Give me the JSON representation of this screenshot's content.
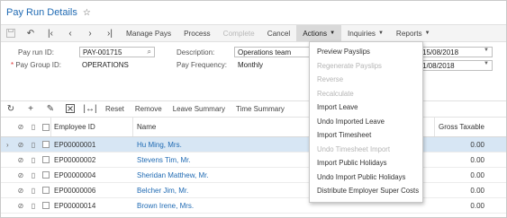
{
  "page": {
    "title": "Pay Run Details"
  },
  "toolbar": {
    "buttons": [
      {
        "label": "Manage Pays",
        "disabled": false
      },
      {
        "label": "Process",
        "disabled": false
      },
      {
        "label": "Complete",
        "disabled": true
      },
      {
        "label": "Cancel",
        "disabled": false
      }
    ],
    "actions_label": "Actions",
    "inquiries_label": "Inquiries",
    "reports_label": "Reports"
  },
  "form": {
    "pay_run_id_label": "Pay run ID:",
    "pay_run_id_value": "PAY-001715",
    "pay_group_id_label": "Pay Group ID:",
    "pay_group_id_value": "OPERATIONS",
    "description_label": "Description:",
    "description_value": "Operations team",
    "pay_frequency_label": "Pay Frequency:",
    "pay_frequency_value": "Monthly",
    "date1_value": "15/08/2018",
    "date2_value": "1/08/2018"
  },
  "grid_toolbar": {
    "reset_label": "Reset",
    "remove_label": "Remove",
    "leave_summary_label": "Leave Summary",
    "time_summary_label": "Time Summary"
  },
  "grid": {
    "columns": {
      "employee_id": "Employee ID",
      "name": "Name",
      "gross_taxable": "Gross Taxable"
    },
    "rows": [
      {
        "employee_id": "EP00000001",
        "name": "Hu Ming, Mrs.",
        "gross_taxable": "0.00",
        "selected": true
      },
      {
        "employee_id": "EP00000002",
        "name": "Stevens Tim, Mr.",
        "gross_taxable": "0.00",
        "selected": false
      },
      {
        "employee_id": "EP00000004",
        "name": "Sheridan Matthew, Mr.",
        "gross_taxable": "0.00",
        "selected": false
      },
      {
        "employee_id": "EP00000006",
        "name": "Belcher Jim, Mr.",
        "gross_taxable": "0.00",
        "selected": false
      },
      {
        "employee_id": "EP00000014",
        "name": "Brown Irene, Mrs.",
        "gross_taxable": "0.00",
        "selected": false
      }
    ]
  },
  "actions_menu": {
    "items": [
      {
        "label": "Preview Payslips",
        "disabled": false
      },
      {
        "label": "Regenerate Payslips",
        "disabled": true
      },
      {
        "label": "Reverse",
        "disabled": true
      },
      {
        "label": "Recalculate",
        "disabled": true
      },
      {
        "label": "Import Leave",
        "disabled": false
      },
      {
        "label": "Undo Imported Leave",
        "disabled": false
      },
      {
        "label": "Import Timesheet",
        "disabled": false
      },
      {
        "label": "Undo Timesheet Import",
        "disabled": true
      },
      {
        "label": "Import Public Holidays",
        "disabled": false
      },
      {
        "label": "Undo Import Public Holidays",
        "disabled": false
      },
      {
        "label": "Distribute Employer Super Costs",
        "disabled": false
      }
    ]
  },
  "colors": {
    "link": "#1f6ab3",
    "selected_row": "#d7e6f4",
    "toolbar_bg": "#f4f4f4"
  }
}
